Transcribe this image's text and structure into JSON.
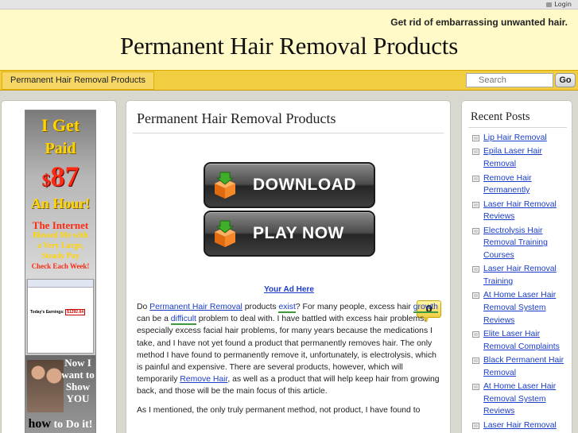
{
  "topbar": {
    "login_label": "Login"
  },
  "header": {
    "tagline": "Get rid of embarrassing unwanted hair.",
    "site_title": "Permanent Hair Removal Products"
  },
  "nav": {
    "active_tab": "Permanent Hair Removal Products",
    "search_placeholder": "Search",
    "go_label": "Go"
  },
  "left_ad": {
    "line1": "I Get",
    "line2": "Paid",
    "amount_symbol": "$",
    "amount": "87",
    "line4": "An Hour!",
    "line5a": "The Internet",
    "line5b": "Blessed Me with",
    "line5c": "a Very Large,",
    "line5d": "Steady Pay",
    "line5e": "Check Each Week!",
    "shot_earnings_label": "Today's Earnings:",
    "shot_earnings_value": "$1292.64",
    "bottom1": "Now I want to Show YOU",
    "bottom2a": "how",
    "bottom2b": "to Do it!"
  },
  "post": {
    "title": "Permanent Hair Removal Products",
    "download_label": "DOWNLOAD",
    "playnow_label": "PLAY NOW",
    "ad_here": "Your Ad Here",
    "comment_count": "0",
    "p1_pre": "Do ",
    "p1_link1": "Permanent Hair Removal",
    "p1_a": " products ",
    "p1_link2": "exist",
    "p1_b": "? For many people, excess hair ",
    "p1_link3": "growth",
    "p1_c": " can be a ",
    "p1_link4": "difficult",
    "p1_d": " problem to deal with. I have battled with excess hair problems, especially excess facial hair problems, for many years because the medications I take, and I have not yet found a product that permanently removes hair. The only method I have found to permanently remove it, unfortunately, is electrolysis, which is painful and expensive. There are several products, however, which will temporarily ",
    "p1_link5": "Remove Hair",
    "p1_e": ", as well as a product that will help keep hair from growing back, and those will be the main focus of this article.",
    "p2": "As I mentioned, the only truly permanent method, not product, I have found to"
  },
  "sidebar": {
    "title": "Recent Posts",
    "items": [
      "Lip Hair Removal",
      "Epila Laser Hair Removal",
      "Remove Hair Permanently",
      "Laser Hair Removal Reviews",
      "Electrolysis Hair Removal Training Courses",
      "Laser Hair Removal Training",
      "At Home Laser Hair Removal System Reviews",
      "Elite Laser Hair Removal Complaints",
      "Black Permanent Hair Removal",
      "At Home Laser Hair Removal System Reviews",
      "Laser Hair Removal Cost"
    ]
  },
  "colors": {
    "header_bg": "#fffac8",
    "nav_bg": "#f1cd42",
    "link": "#1a3cc8",
    "page_bg": "#d9d8cf"
  }
}
